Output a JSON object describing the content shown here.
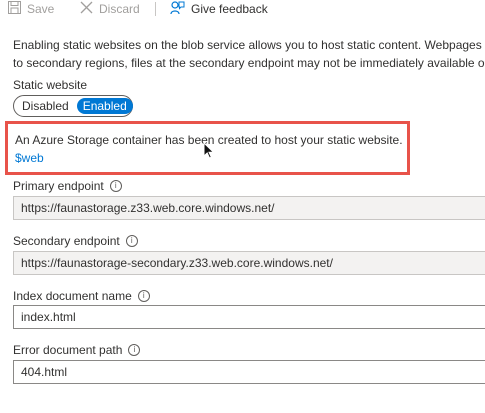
{
  "toolbar": {
    "save_label": "Save",
    "discard_label": "Discard",
    "feedback_label": "Give feedback"
  },
  "description": {
    "line1": "Enabling static websites on the blob service allows you to host static content. Webpages ma",
    "line2": "to secondary regions, files at the secondary endpoint may not be immediately available or in"
  },
  "static_website": {
    "label": "Static website",
    "options": [
      "Disabled",
      "Enabled"
    ],
    "selected": "Enabled"
  },
  "callout": {
    "message": "An Azure Storage container has been created to host your static website.",
    "link": "$web",
    "border_color": "#e8534a"
  },
  "primary_endpoint": {
    "label": "Primary endpoint",
    "value": "https://faunastorage.z33.web.core.windows.net/"
  },
  "secondary_endpoint": {
    "label": "Secondary endpoint",
    "value": "https://faunastorage-secondary.z33.web.core.windows.net/"
  },
  "index_document": {
    "label": "Index document name",
    "value": "index.html"
  },
  "error_document": {
    "label": "Error document path",
    "value": "404.html"
  },
  "colors": {
    "accent": "#0078d4",
    "disabled_text": "#a19f9d"
  }
}
